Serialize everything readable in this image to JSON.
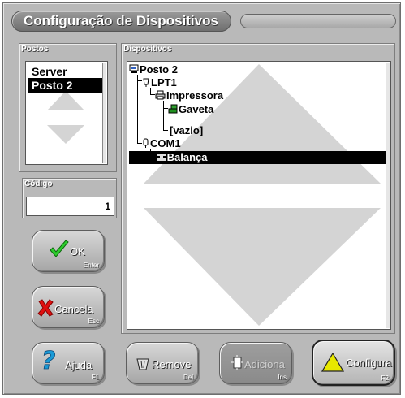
{
  "window": {
    "title": "Configuração de Dispositivos"
  },
  "postos": {
    "label": "Postos",
    "items": [
      {
        "label": "Server",
        "selected": false
      },
      {
        "label": "Posto 2",
        "selected": true
      }
    ]
  },
  "codigo": {
    "label": "Código",
    "value": "1"
  },
  "dispositivos": {
    "label": "Dispositivos",
    "tree": {
      "root": "Posto 2",
      "lpt1": "LPT1",
      "impressora": "Impressora",
      "gaveta": "Gaveta",
      "vazio": "[vazio]",
      "com1": "COM1",
      "balanca": "Balança"
    },
    "selected": "Balança"
  },
  "buttons": {
    "ok": {
      "label": "OK",
      "key": "Enter",
      "icon": "check-icon"
    },
    "cancela": {
      "label": "Cancela",
      "key": "Esc",
      "icon": "x-icon"
    },
    "ajuda": {
      "label": "Ajuda",
      "key": "F1",
      "icon": "question-icon"
    },
    "remove": {
      "label": "Remove",
      "key": "Del",
      "icon": "trash-icon",
      "enabled": true
    },
    "adiciona": {
      "label": "Adiciona",
      "key": "Ins",
      "icon": "add-icon",
      "enabled": false
    },
    "configura": {
      "label": "Configura",
      "key": "F2",
      "icon": "warning-triangle-icon",
      "focused": true
    }
  },
  "colors": {
    "window_bg": "#b9b9b9",
    "selection_bg": "#000000",
    "ok_green": "#2ecc2e",
    "cancel_red": "#e01010",
    "help_blue": "#1a9ad6",
    "configure_yellow": "#e8e800"
  }
}
